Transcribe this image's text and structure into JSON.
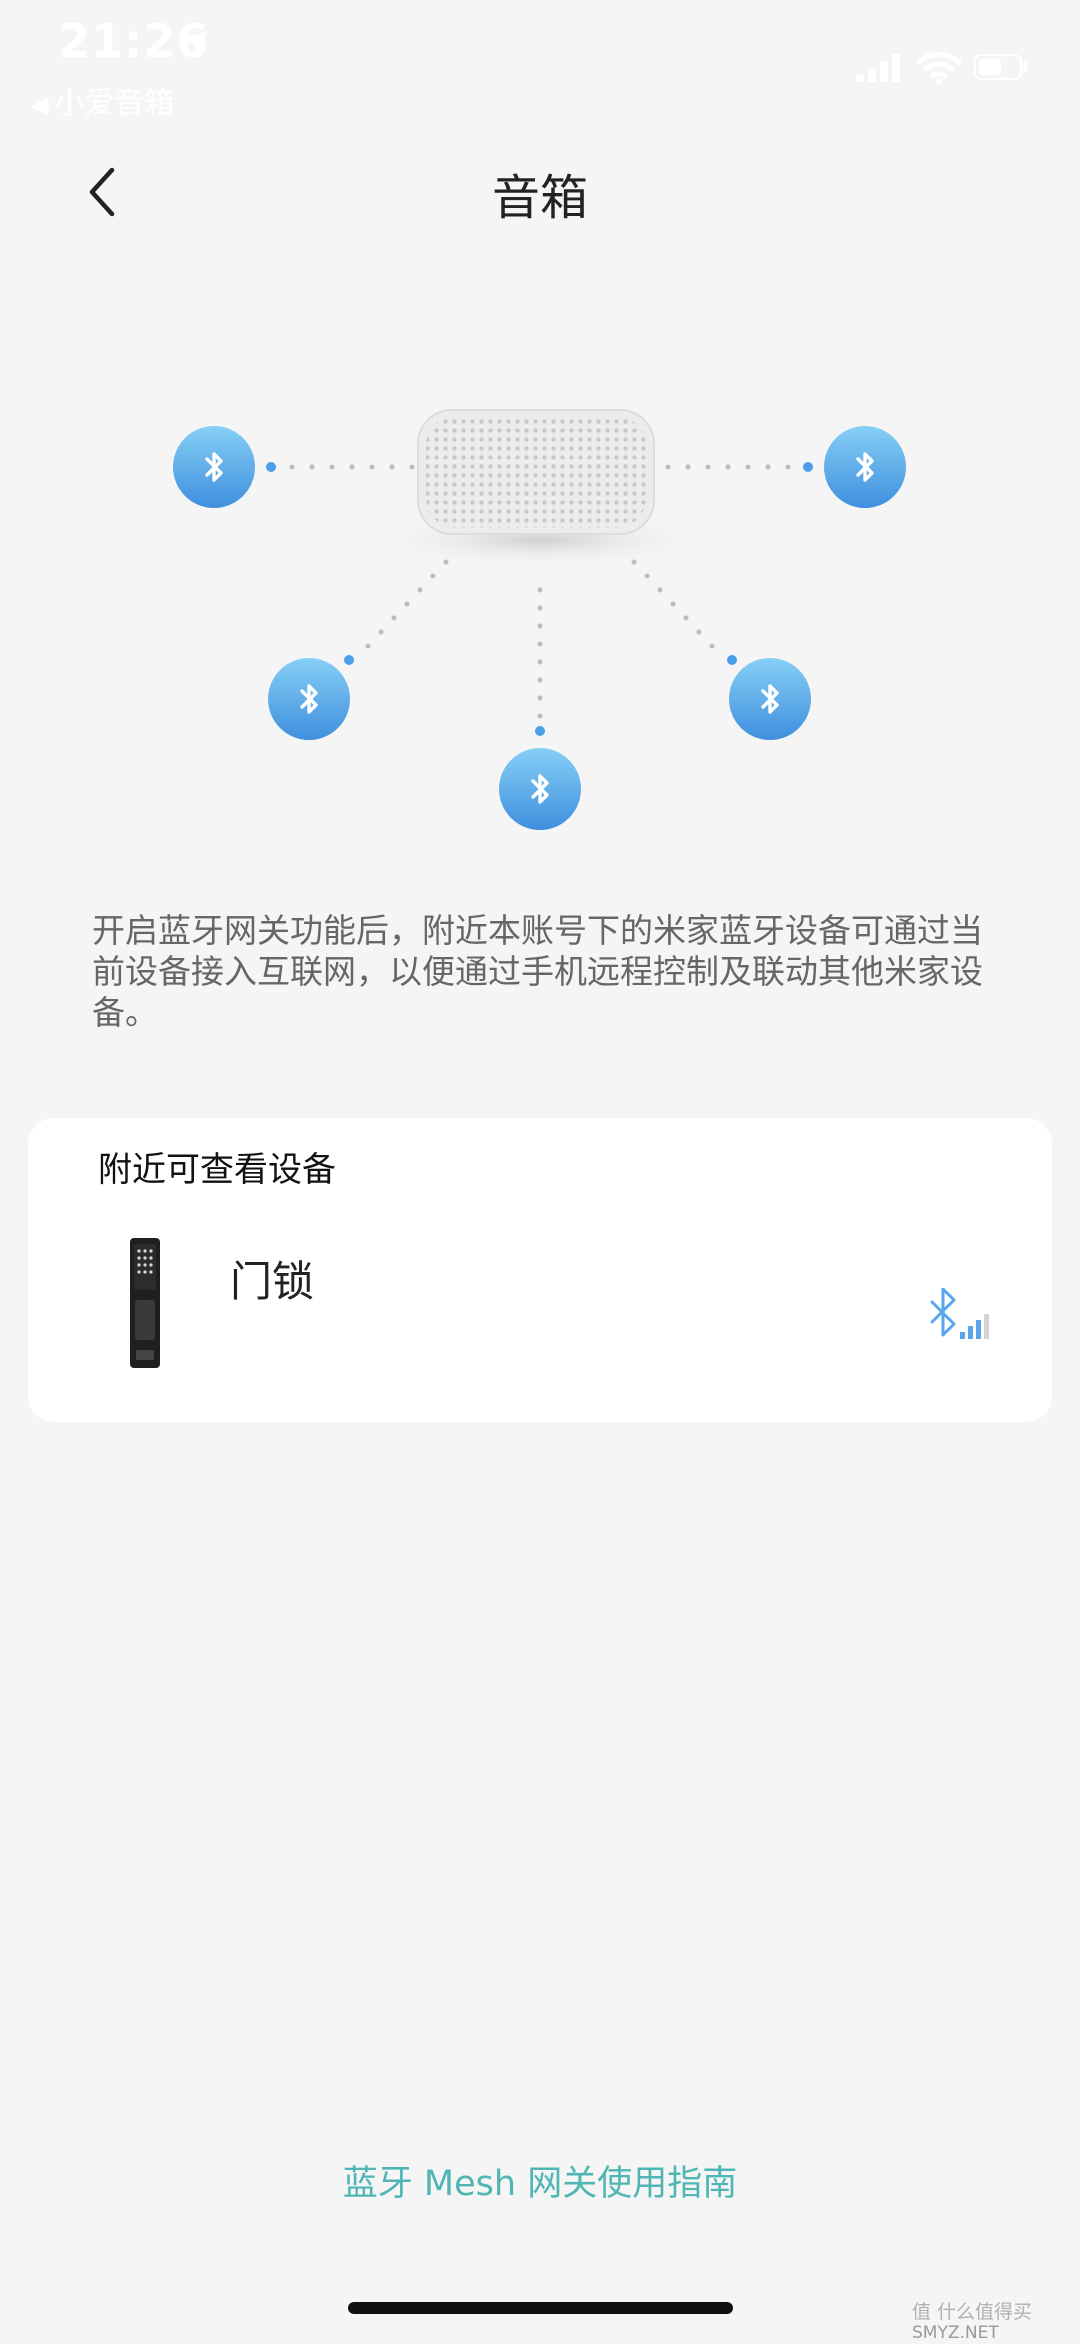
{
  "status_bar": {
    "time": "21:26",
    "back_app_label": "小爱音箱"
  },
  "header": {
    "title": "音箱"
  },
  "description": "开启蓝牙网关功能后，附近本账号下的米家蓝牙设备可通过当前设备接入互联网，以便通过手机远程控制及联动其他米家设备。",
  "nearby_devices": {
    "title": "附近可查看设备",
    "items": [
      {
        "name": "门锁",
        "icon": "door-lock-image",
        "signal_icon": "bluetooth-signal-icon"
      }
    ]
  },
  "footer": {
    "guide_link": "蓝牙 Mesh 网关使用指南"
  },
  "watermark": {
    "line1": "值 什么值得买",
    "line2": "SMYZ.NET"
  },
  "colors": {
    "background": "#f5f5f5",
    "accent_link": "#4fb6b4",
    "bluetooth_blue": "#4a9fe6"
  }
}
